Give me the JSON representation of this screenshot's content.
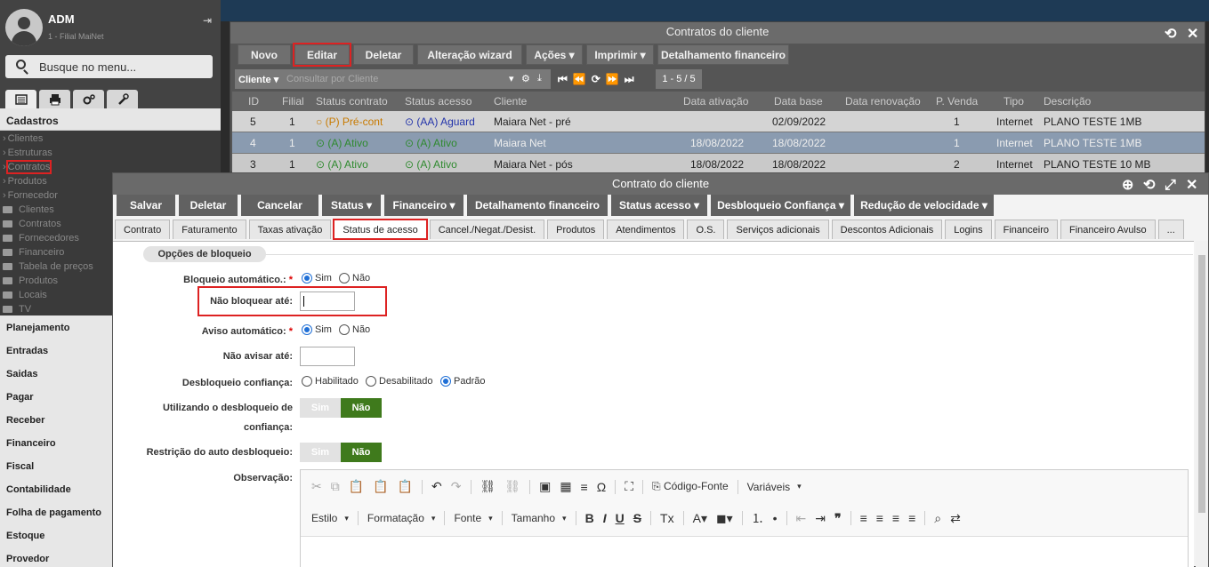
{
  "sidebar": {
    "user_name": "ADM",
    "user_sub": "1 - Filial MaiNet",
    "search_placeholder": "Busque no menu...",
    "section_cadastros": "Cadastros",
    "items": [
      "Clientes",
      "Estruturas",
      "Contratos",
      "Produtos",
      "Fornecedor"
    ],
    "folders": [
      "Clientes",
      "Contratos",
      "Fornecedores",
      "Financeiro",
      "Tabela de preços",
      "Produtos",
      "Locais",
      "TV"
    ],
    "sections": [
      "Planejamento",
      "Entradas",
      "Saidas",
      "Pagar",
      "Receber",
      "Financeiro",
      "Fiscal",
      "Contabilidade",
      "Folha de pagamento",
      "Estoque",
      "Provedor"
    ]
  },
  "win1": {
    "title": "Contratos do cliente",
    "buttons": [
      "Novo",
      "Editar",
      "Deletar",
      "Alteração wizard",
      "Ações",
      "Imprimir",
      "Detalhamento financeiro"
    ],
    "filter_label": "Cliente",
    "filter_placeholder": "Consultar por Cliente",
    "page_info": "1 - 5 / 5",
    "columns": [
      "ID",
      "Filial",
      "Status contrato",
      "Status acesso",
      "Cliente",
      "Data ativação",
      "Data base",
      "Data renovação",
      "P. Venda",
      "Tipo",
      "Descrição"
    ],
    "rows": [
      [
        "5",
        "1",
        "(P) Pré-cont",
        "(AA) Aguard",
        "Maiara Net - pré",
        "",
        "02/09/2022",
        "",
        "1",
        "Internet",
        "PLANO TESTE 1MB"
      ],
      [
        "4",
        "1",
        "(A) Ativo",
        "(A) Ativo",
        "Maiara Net",
        "18/08/2022",
        "18/08/2022",
        "",
        "1",
        "Internet",
        "PLANO TESTE 1MB"
      ],
      [
        "3",
        "1",
        "(A) Ativo",
        "(A) Ativo",
        "Maiara Net - pós",
        "18/08/2022",
        "18/08/2022",
        "",
        "2",
        "Internet",
        "PLANO TESTE 10 MB"
      ]
    ]
  },
  "win2": {
    "title": "Contrato do cliente",
    "buttons": [
      "Salvar",
      "Deletar",
      "Cancelar",
      "Status",
      "Financeiro",
      "Detalhamento financeiro",
      "Status acesso",
      "Desbloqueio Confiança",
      "Redução de velocidade"
    ],
    "tabs": [
      "Contrato",
      "Faturamento",
      "Taxas ativação",
      "Status de acesso",
      "Cancel./Negat./Desist.",
      "Produtos",
      "Atendimentos",
      "O.S.",
      "Serviços adicionais",
      "Descontos Adicionais",
      "Logins",
      "Financeiro",
      "Financeiro Avulso",
      "..."
    ],
    "legend": "Opções de bloqueio",
    "f_bloqueio": "Bloqueio automático.:",
    "f_nao_bloquear": "Não bloquear até:",
    "f_aviso": "Aviso automático:",
    "f_nao_avisar": "Não avisar até:",
    "f_desbloqueio": "Desbloqueio confiança:",
    "f_utilizando1": "Utilizando o desbloqueio de",
    "f_utilizando2": "confiança:",
    "f_restricao": "Restrição do auto desbloqueio:",
    "f_obs": "Observação:",
    "sim": "Sim",
    "nao": "Não",
    "habilitado": "Habilitado",
    "desabilitado": "Desabilitado",
    "padrao": "Padrão",
    "toggle_sim": "Sim",
    "toggle_nao": "Não",
    "editor": {
      "codigo_fonte": "Código-Fonte",
      "variaveis": "Variáveis",
      "estilo": "Estilo",
      "formatacao": "Formatação",
      "fonte": "Fonte",
      "tamanho": "Tamanho"
    }
  },
  "colors": {
    "accent_red": "#d22222",
    "green": "#3f7a1c",
    "radio_blue": "#1f6fd6"
  }
}
